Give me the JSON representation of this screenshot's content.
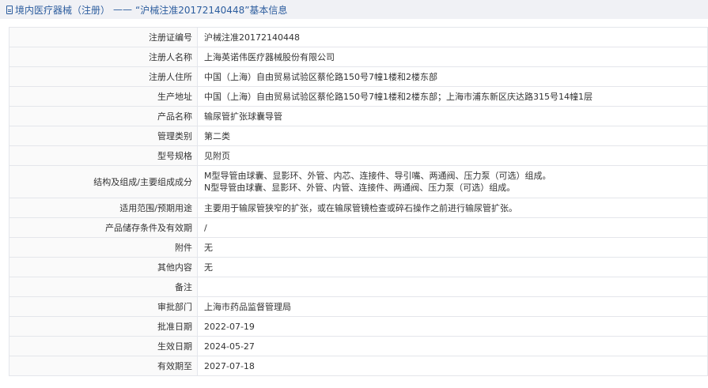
{
  "title": {
    "icon": "document-icon",
    "category": "境内医疗器械（注册）",
    "separator": "——",
    "subject": "“沪械注准20172140448”基本信息"
  },
  "rows": [
    {
      "label": "注册证编号",
      "value": "沪械注准20172140448"
    },
    {
      "label": "注册人名称",
      "value": "上海英诺伟医疗器械股份有限公司"
    },
    {
      "label": "注册人住所",
      "value": "中国（上海）自由贸易试验区蔡伦路150号7幢1楼和2楼东部"
    },
    {
      "label": "生产地址",
      "value": "中国（上海）自由贸易试验区蔡伦路150号7幢1楼和2楼东部；上海市浦东新区庆达路315号14幢1层"
    },
    {
      "label": "产品名称",
      "value": "输尿管扩张球囊导管"
    },
    {
      "label": "管理类别",
      "value": "第二类"
    },
    {
      "label": "型号规格",
      "value": "见附页"
    },
    {
      "label": "结构及组成/主要组成成分",
      "value_line1": "M型导管由球囊、显影环、外管、内芯、连接件、导引嘴、两通阀、压力泵（可选）组成。",
      "value_line2": "N型导管由球囊、显影环、外管、内管、连接件、两通阀、压力泵（可选）组成。"
    },
    {
      "label": "适用范围/预期用途",
      "value": "主要用于输尿管狭窄的扩张，或在输尿管镜检查或碎石操作之前进行输尿管扩张。"
    },
    {
      "label": "产品储存条件及有效期",
      "value": "/"
    },
    {
      "label": "附件",
      "value": "无"
    },
    {
      "label": "其他内容",
      "value": "无"
    },
    {
      "label": "备注",
      "value": ""
    },
    {
      "label": "审批部门",
      "value": "上海市药品监督管理局"
    },
    {
      "label": "批准日期",
      "value": "2022-07-19"
    },
    {
      "label": "生效日期",
      "value": "2024-05-27"
    },
    {
      "label": "有效期至",
      "value": "2027-07-18"
    }
  ],
  "colors": {
    "title_text": "#2c5d9e",
    "title_bg": "#f0f1f5",
    "border": "#e4e6eb"
  }
}
